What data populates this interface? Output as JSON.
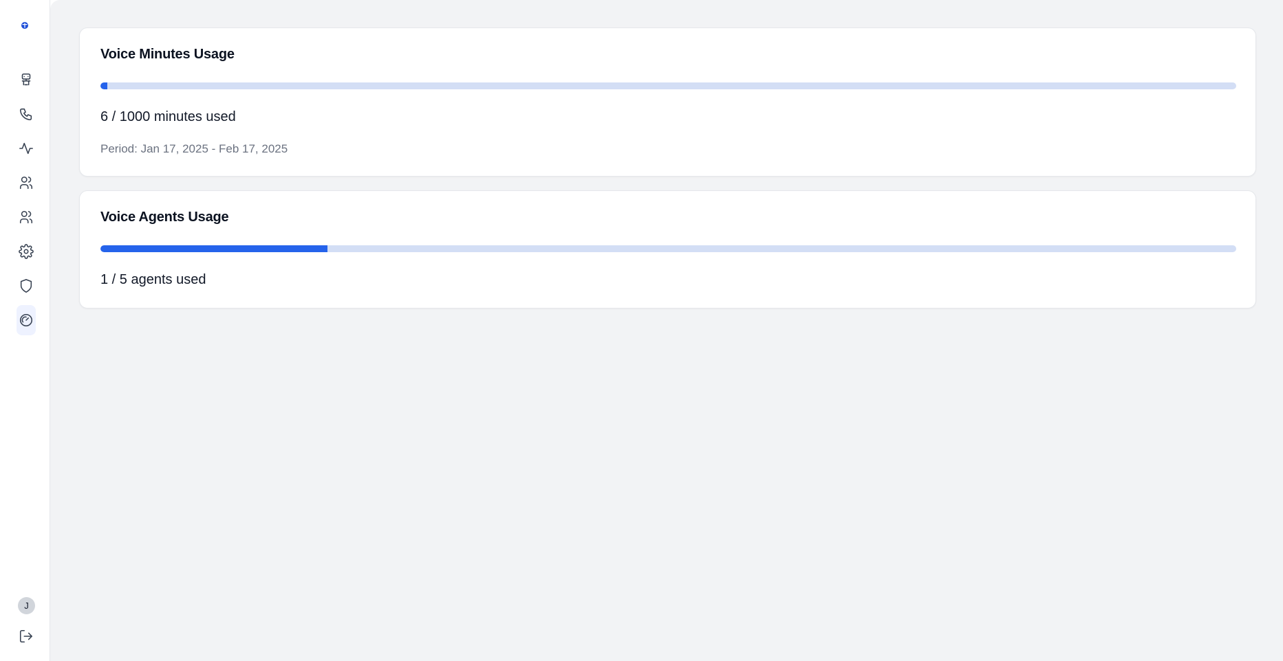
{
  "sidebar": {
    "logo": "brand-logo",
    "items": [
      {
        "icon": "bot-icon"
      },
      {
        "icon": "phone-icon"
      },
      {
        "icon": "activity-icon"
      },
      {
        "icon": "users-icon"
      },
      {
        "icon": "contacts-icon"
      },
      {
        "icon": "gear-icon"
      },
      {
        "icon": "shield-icon"
      },
      {
        "icon": "gauge-icon",
        "active": true
      }
    ],
    "avatar_initial": "J",
    "logout_icon": "logout-icon"
  },
  "cards": {
    "minutes": {
      "title": "Voice Minutes Usage",
      "used": 6,
      "total": 1000,
      "progress_fraction": 0.006,
      "usage_label": "6 / 1000 minutes used",
      "period_label": "Period: Jan 17, 2025 - Feb 17, 2025"
    },
    "agents": {
      "title": "Voice Agents Usage",
      "used": 1,
      "total": 5,
      "progress_fraction": 0.2,
      "usage_label": "1 / 5 agents used"
    }
  },
  "colors": {
    "accent": "#2563eb",
    "track": "#d3def5",
    "background": "#f2f3f5"
  }
}
